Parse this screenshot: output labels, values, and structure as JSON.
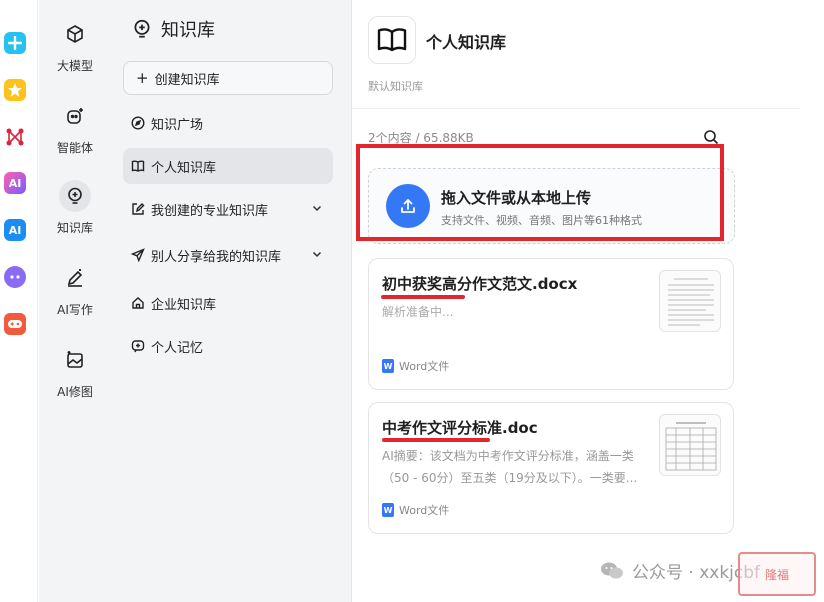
{
  "dock": {
    "icons": [
      "app-tencent-icon",
      "star-app-icon",
      "network-app-icon",
      "ai-orb-app-icon",
      "ai-app-icon",
      "bot-app-icon",
      "game-app-icon"
    ]
  },
  "rail": {
    "items": [
      {
        "label": "大模型",
        "icon": "cube-icon"
      },
      {
        "label": "智能体",
        "icon": "agent-icon"
      },
      {
        "label": "知识库",
        "icon": "bulb-icon"
      },
      {
        "label": "AI写作",
        "icon": "pen-icon"
      },
      {
        "label": "AI修图",
        "icon": "image-icon"
      }
    ]
  },
  "sidebar": {
    "title": "知识库",
    "create_label": "创建知识库",
    "items": [
      {
        "label": "知识广场"
      },
      {
        "label": "个人知识库"
      },
      {
        "label": "我创建的专业知识库"
      },
      {
        "label": "别人分享给我的知识库"
      },
      {
        "label": "企业知识库"
      },
      {
        "label": "个人记忆"
      }
    ]
  },
  "main": {
    "kb_name": "个人知识库",
    "kb_desc": "默认知识库",
    "count_text": "2个内容 / 65.88KB",
    "upload": {
      "title": "拖入文件或从本地上传",
      "subtitle": "支持文件、视频、音频、图片等61种格式"
    },
    "files": [
      {
        "title": "初中获奖高分作文范文.docx",
        "status": "解析准备中...",
        "type": "Word文件"
      },
      {
        "title": "中考作文评分标准.doc",
        "summary": "AI摘要：该文档为中考作文评分标准，涵盖一类（50 - 60分）至五类（19分及以下）。一类要...",
        "type": "Word文件"
      }
    ]
  },
  "watermark": {
    "text": "公众号 · xxkjcbf",
    "logo_text": "隆福"
  },
  "colors": {
    "accent": "#3478f6",
    "highlight_red": "#e3262c"
  }
}
